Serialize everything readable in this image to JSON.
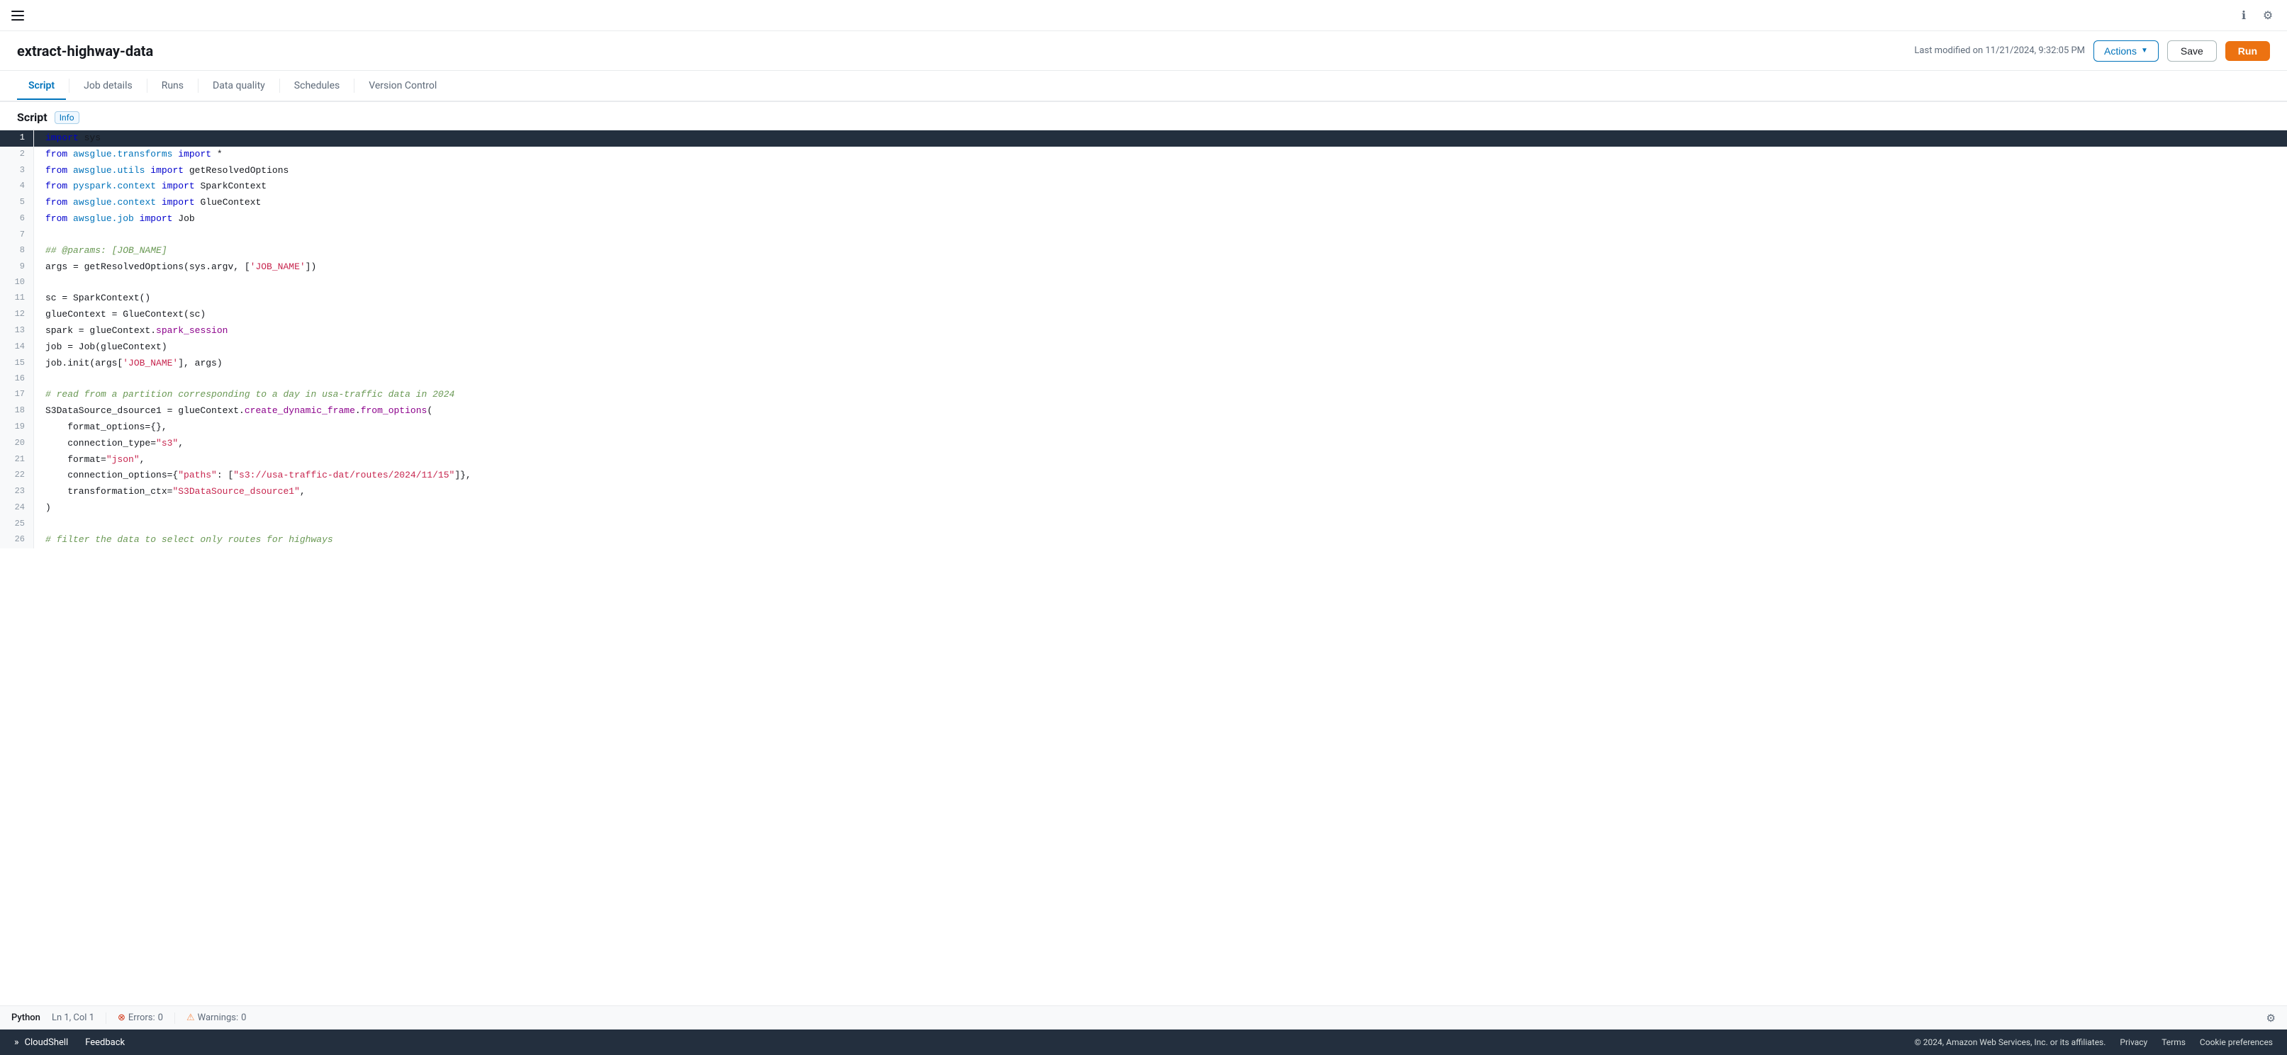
{
  "topNav": {
    "hamburger": "menu",
    "infoLabel": "ℹ",
    "settingsLabel": "⚙"
  },
  "header": {
    "title": "extract-highway-data",
    "lastModified": "Last modified on 11/21/2024, 9:32:05 PM",
    "actionsLabel": "Actions",
    "saveLabel": "Save",
    "runLabel": "Run"
  },
  "tabs": [
    {
      "id": "script",
      "label": "Script",
      "active": true
    },
    {
      "id": "job-details",
      "label": "Job details",
      "active": false
    },
    {
      "id": "runs",
      "label": "Runs",
      "active": false
    },
    {
      "id": "data-quality",
      "label": "Data quality",
      "active": false
    },
    {
      "id": "schedules",
      "label": "Schedules",
      "active": false
    },
    {
      "id": "version-control",
      "label": "Version Control",
      "active": false
    }
  ],
  "scriptSection": {
    "label": "Script",
    "infoLabel": "Info"
  },
  "statusBar": {
    "language": "Python",
    "position": "Ln 1, Col 1",
    "errorPrefix": "Errors:",
    "errorCount": "0",
    "warningPrefix": "Warnings:",
    "warningCount": "0"
  },
  "footer": {
    "cloudshellLabel": "CloudShell",
    "feedbackLabel": "Feedback",
    "copyright": "© 2024, Amazon Web Services, Inc. or its affiliates.",
    "privacyLabel": "Privacy",
    "termsLabel": "Terms",
    "cookieLabel": "Cookie preferences"
  },
  "codeLines": [
    {
      "num": 1,
      "content": "import sys",
      "active": true
    },
    {
      "num": 2,
      "content": "from awsglue.transforms import *"
    },
    {
      "num": 3,
      "content": "from awsglue.utils import getResolvedOptions"
    },
    {
      "num": 4,
      "content": "from pyspark.context import SparkContext"
    },
    {
      "num": 5,
      "content": "from awsglue.context import GlueContext"
    },
    {
      "num": 6,
      "content": "from awsglue.job import Job"
    },
    {
      "num": 7,
      "content": ""
    },
    {
      "num": 8,
      "content": "## @params: [JOB_NAME]"
    },
    {
      "num": 9,
      "content": "args = getResolvedOptions(sys.argv, ['JOB_NAME'])"
    },
    {
      "num": 10,
      "content": ""
    },
    {
      "num": 11,
      "content": "sc = SparkContext()"
    },
    {
      "num": 12,
      "content": "glueContext = GlueContext(sc)"
    },
    {
      "num": 13,
      "content": "spark = glueContext.spark_session"
    },
    {
      "num": 14,
      "content": "job = Job(glueContext)"
    },
    {
      "num": 15,
      "content": "job.init(args['JOB_NAME'], args)"
    },
    {
      "num": 16,
      "content": ""
    },
    {
      "num": 17,
      "content": "# read from a partition corresponding to a day in usa-traffic data in 2024"
    },
    {
      "num": 18,
      "content": "S3DataSource_dsource1 = glueContext.create_dynamic_frame.from_options("
    },
    {
      "num": 19,
      "content": "    format_options={},"
    },
    {
      "num": 20,
      "content": "    connection_type=\"s3\","
    },
    {
      "num": 21,
      "content": "    format=\"json\","
    },
    {
      "num": 22,
      "content": "    connection_options={\"paths\": [\"s3://usa-traffic-dat/routes/2024/11/15\"]},"
    },
    {
      "num": 23,
      "content": "    transformation_ctx=\"S3DataSource_dsource1\","
    },
    {
      "num": 24,
      "content": ")"
    },
    {
      "num": 25,
      "content": ""
    },
    {
      "num": 26,
      "content": "# filter the data to select only routes for highways"
    }
  ]
}
